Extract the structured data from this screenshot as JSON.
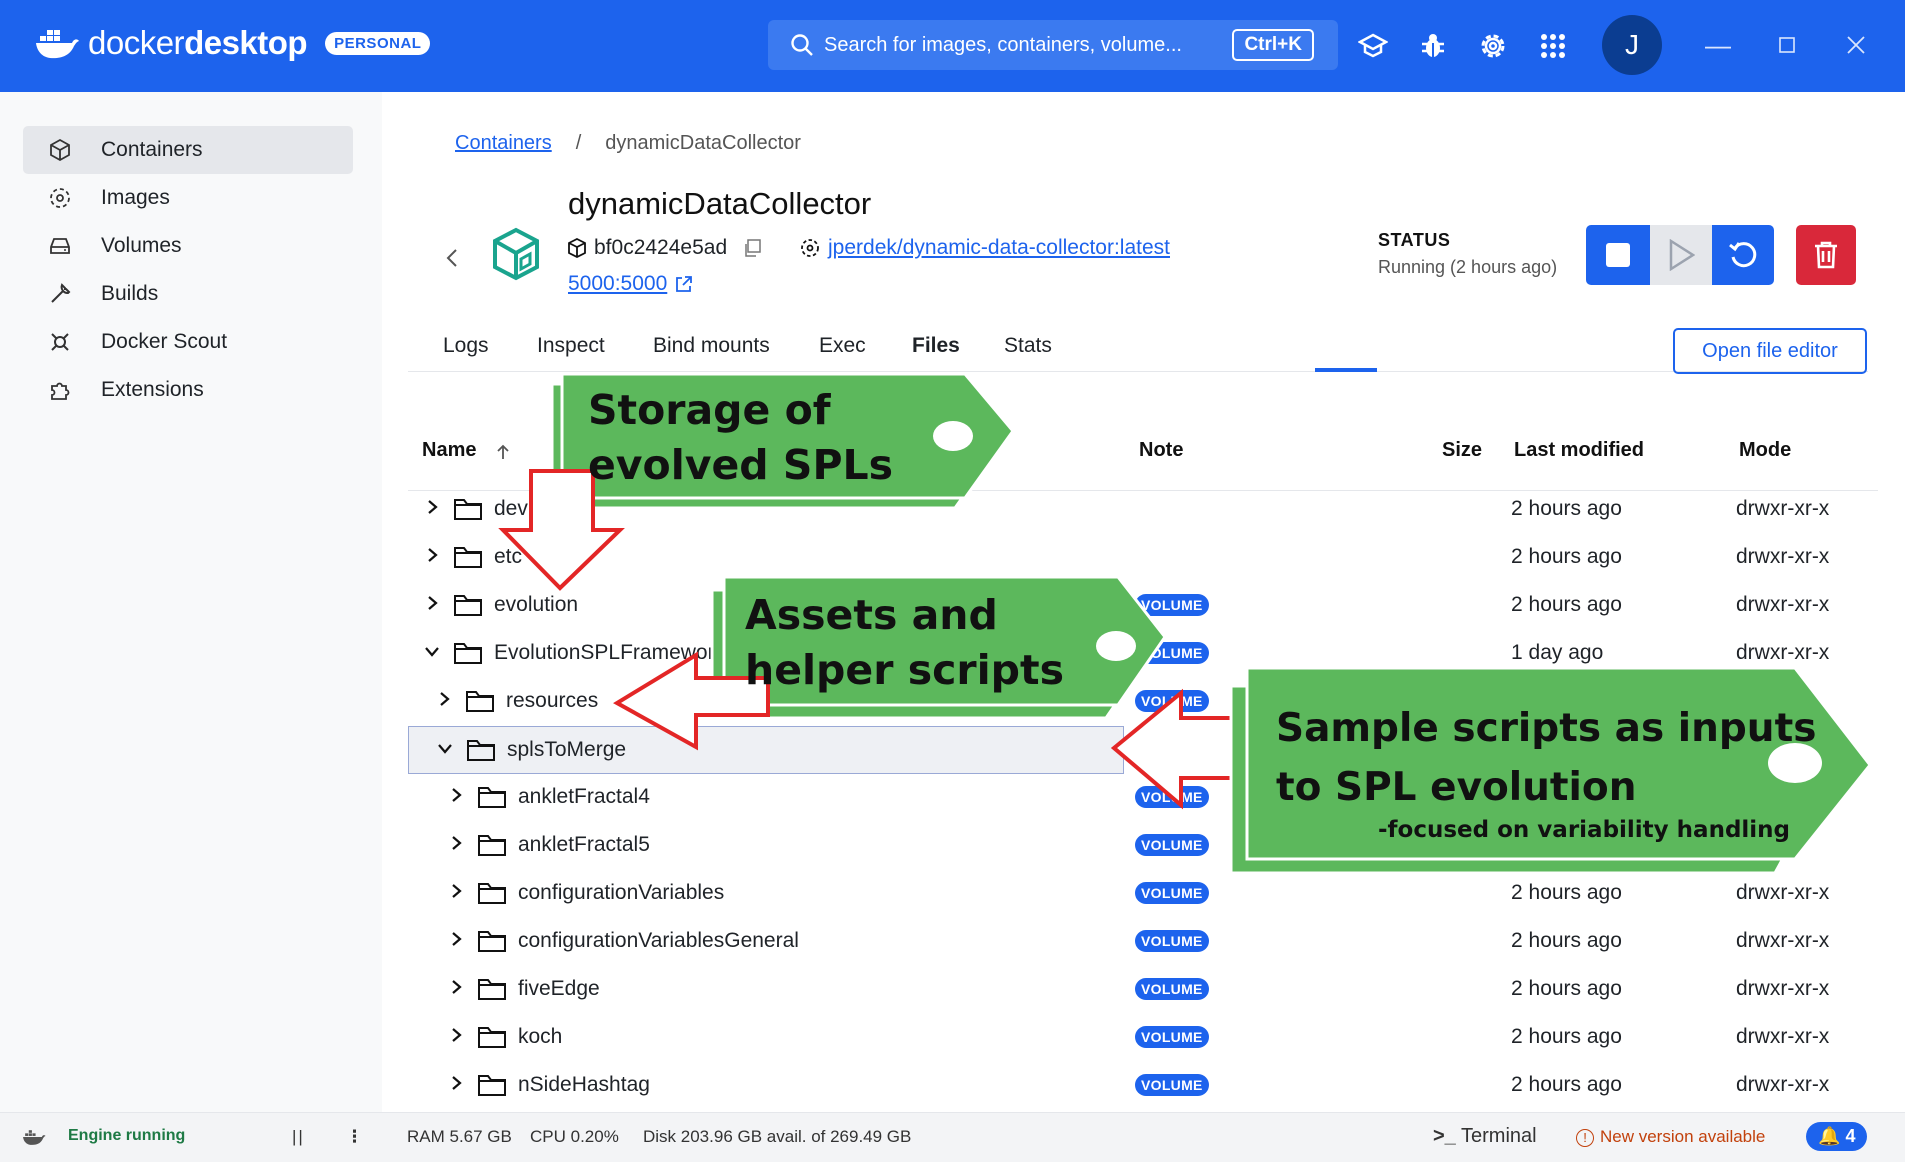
{
  "app": {
    "brand_light": "docker",
    "brand_bold": "desktop",
    "plan_badge": "PERSONAL",
    "search_placeholder": "Search for images, containers, volume...",
    "search_shortcut": "Ctrl+K",
    "avatar_initial": "J",
    "accent_color": "#1d63ed"
  },
  "sidebar": {
    "items": [
      {
        "label": "Containers",
        "icon": "container-icon"
      },
      {
        "label": "Images",
        "icon": "image-icon"
      },
      {
        "label": "Volumes",
        "icon": "volume-icon"
      },
      {
        "label": "Builds",
        "icon": "wrench-icon"
      },
      {
        "label": "Docker Scout",
        "icon": "scout-icon"
      },
      {
        "label": "Extensions",
        "icon": "puzzle-icon"
      }
    ]
  },
  "breadcrumb": {
    "root": "Containers",
    "separator": "/",
    "current": "dynamicDataCollector"
  },
  "container": {
    "name": "dynamicDataCollector",
    "id": "bf0c2424e5ad",
    "image": "jperdek/dynamic-data-collector:latest",
    "port": "5000:5000",
    "status_label": "STATUS",
    "status_value": "Running (2 hours ago)"
  },
  "tabs": [
    "Logs",
    "Inspect",
    "Bind mounts",
    "Exec",
    "Files",
    "Stats"
  ],
  "active_tab": "Files",
  "open_editor_label": "Open file editor",
  "table": {
    "headers": {
      "name": "Name",
      "note": "Note",
      "size": "Size",
      "modified": "Last modified",
      "mode": "Mode"
    },
    "volume_badge": "VOLUME",
    "rows": [
      {
        "name": "dev",
        "modified": "2 hours ago",
        "mode": "drwxr-xr-x"
      },
      {
        "name": "etc",
        "modified": "2 hours ago",
        "mode": "drwxr-xr-x"
      },
      {
        "name": "evolution",
        "modified": "2 hours ago",
        "mode": "drwxr-xr-x"
      },
      {
        "name": "EvolutionSPLFramework",
        "modified": "1 day ago",
        "mode": "drwxr-xr-x"
      },
      {
        "name": "resources",
        "modified": "",
        "mode": ""
      },
      {
        "name": "splsToMerge",
        "modified": "",
        "mode": ""
      },
      {
        "name": "ankletFractal4",
        "modified": "",
        "mode": ""
      },
      {
        "name": "ankletFractal5",
        "modified": "",
        "mode": ""
      },
      {
        "name": "configurationVariables",
        "modified": "2 hours ago",
        "mode": "drwxr-xr-x"
      },
      {
        "name": "configurationVariablesGeneral",
        "modified": "2 hours ago",
        "mode": "drwxr-xr-x"
      },
      {
        "name": "fiveEdge",
        "modified": "2 hours ago",
        "mode": "drwxr-xr-x"
      },
      {
        "name": "koch",
        "modified": "2 hours ago",
        "mode": "drwxr-xr-x"
      },
      {
        "name": "nSideHashtag",
        "modified": "2 hours ago",
        "mode": "drwxr-xr-x"
      }
    ]
  },
  "footer": {
    "engine": "Engine running",
    "ram": "RAM 5.67 GB",
    "cpu": "CPU 0.20%",
    "disk": "Disk 203.96 GB avail. of 269.49 GB",
    "terminal": "Terminal",
    "update": "New version available",
    "notifications": "4"
  },
  "annotations": {
    "tag1_line1": "Storage of",
    "tag1_line2": "evolved SPLs",
    "tag2_line1": "Assets and",
    "tag2_line2": "helper scripts",
    "tag3_line1": "Sample scripts as inputs",
    "tag3_line2": "to SPL evolution",
    "tag3_line3": "-focused on variability handling",
    "tag_color": "#5cb85c"
  }
}
